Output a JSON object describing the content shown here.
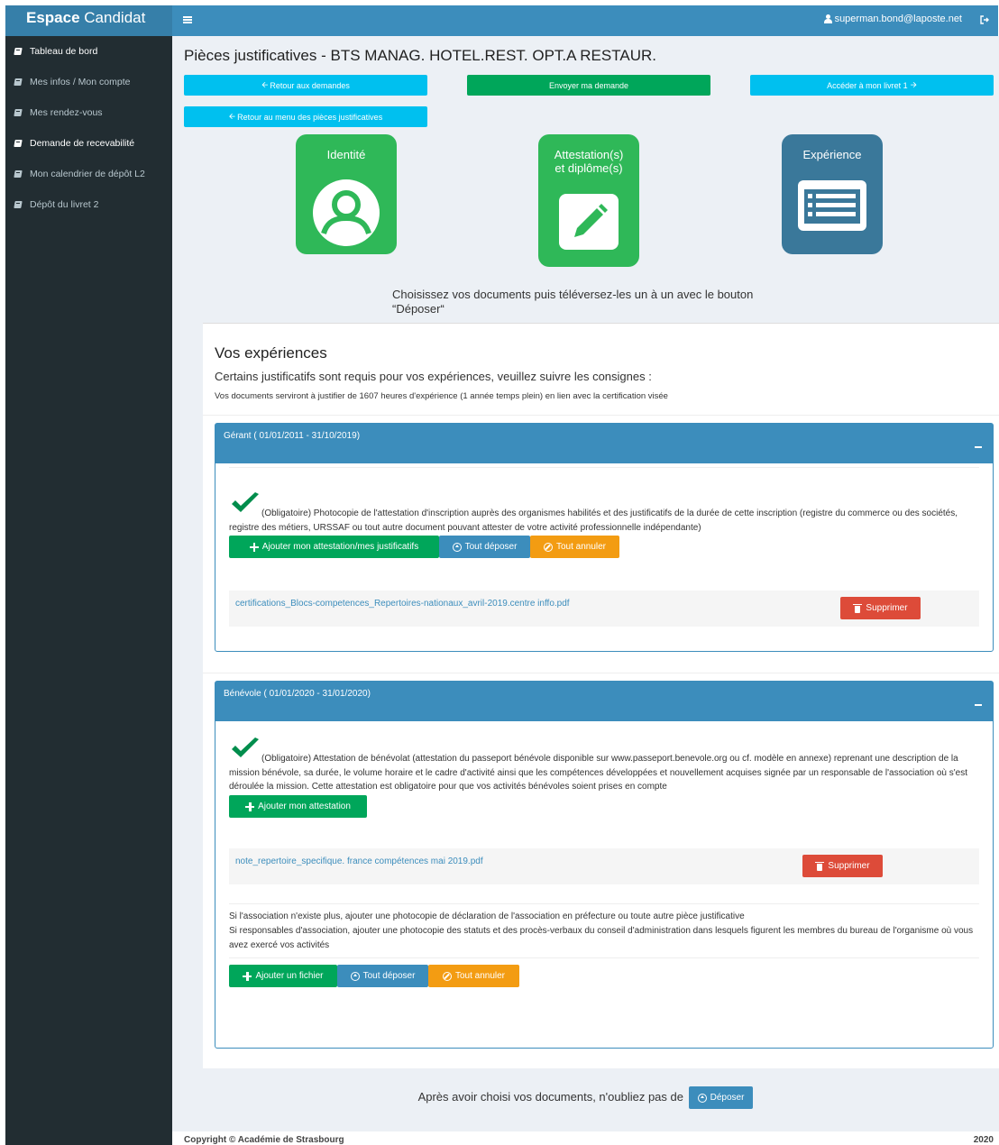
{
  "brand": {
    "bold": "Espace",
    "rest": " Candidat"
  },
  "sidebar": {
    "items": [
      {
        "label": "Tableau de bord"
      },
      {
        "label": "Mes infos / Mon compte"
      },
      {
        "label": "Mes rendez-vous"
      },
      {
        "label": "Demande de recevabilité"
      },
      {
        "label": "Mon calendrier de dépôt L2"
      },
      {
        "label": "Dépôt du livret 2"
      }
    ]
  },
  "topbar": {
    "user_email": "superman.bond@laposte.net"
  },
  "page": {
    "title": "Pièces justificatives - BTS MANAG. HOTEL.REST. OPT.A RESTAUR.",
    "btn_back_requests": "Retour aux demandes",
    "btn_send": "Envoyer ma demande",
    "btn_livret": "Accéder à mon livret 1",
    "btn_back_menu": "Retour au menu des pièces justificatives"
  },
  "tiles": {
    "identity": "Identité",
    "attest_line1": "Attestation(s)",
    "attest_line2": "et diplôme(s)",
    "experience": "Expérience"
  },
  "hint": "Choisissez vos documents puis téléversez-les un à un avec le bouton “Déposer“",
  "panel": {
    "title": "Vos expériences",
    "subtitle": "Certains justificatifs sont requis pour vos expériences, veuillez suivre les consignes :",
    "note": "Vos documents serviront à justifier de 1607 heures d'expérience (1 année temps plein) en lien avec la certification visée"
  },
  "experiences": [
    {
      "heading": "Gérant ( 01/01/2011 - 31/10/2019)",
      "requirement": "(Obligatoire) Photocopie de l'attestation d'inscription auprès des organismes habilités et des justificatifs de la durée de cette inscription (registre du commerce ou des sociétés, registre des métiers, URSSAF ou tout autre document pouvant attester de votre activité professionnelle indépendante)",
      "add_label": "Ajouter mon attestation/mes justificatifs",
      "upload_all_label": "Tout déposer",
      "cancel_all_label": "Tout annuler",
      "file_name": "certifications_Blocs-competences_Repertoires-nationaux_avril-2019.centre inffo.pdf",
      "delete_label": "Supprimer"
    },
    {
      "heading": "Bénévole ( 01/01/2020 - 31/01/2020)",
      "requirement": "(Obligatoire) Attestation de bénévolat (attestation du passeport bénévole disponible sur www.passeport.benevole.org ou cf. modèle en annexe) reprenant une description de la mission bénévole, sa durée, le volume horaire et le cadre d'activité ainsi que les compétences développées et nouvellement acquises signée par un responsable de l'association où s'est déroulée la mission. Cette attestation est obligatoire pour que vos activités bénévoles soient prises en compte",
      "add_label": "Ajouter mon attestation",
      "file_name": "note_repertoire_specifique. france compétences mai 2019.pdf",
      "delete_label": "Supprimer",
      "extra_note_1": "Si l'association n'existe plus, ajouter une photocopie de déclaration de l'association en préfecture ou toute autre pièce justificative",
      "extra_note_2": "Si responsables d'association, ajouter une photocopie des statuts et des procès-verbaux du conseil d'administration dans lesquels figurent les membres du bureau de l'organisme où vous avez exercé vos activités",
      "add_file_label": "Ajouter un fichier",
      "upload_all_label": "Tout déposer",
      "cancel_all_label": "Tout annuler"
    }
  ],
  "footer": {
    "reminder": "Après avoir choisi vos documents, n'oubliez pas de",
    "deposit_label": "Déposer",
    "copyright": "Copyright © Académie de Strasbourg",
    "year": "2020"
  },
  "colors": {
    "sidebar": "#222d32",
    "brand": "#367fa9",
    "primary": "#3c8dbc",
    "info": "#00c0ef",
    "success": "#00a65a",
    "warning": "#f39c12",
    "danger": "#dd4b39",
    "tile_green": "#2fb858",
    "tile_teal": "#3a789a"
  }
}
